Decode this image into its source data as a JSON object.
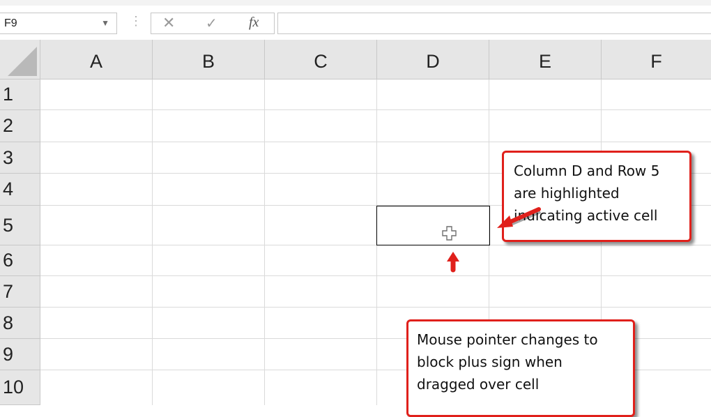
{
  "namebox": {
    "value": "F9"
  },
  "formula": {
    "cancel_symbol": "✕",
    "enter_symbol": "✓",
    "fx_label": "fx",
    "value": ""
  },
  "columns": [
    "A",
    "B",
    "C",
    "D",
    "E",
    "F"
  ],
  "rows": [
    "1",
    "2",
    "3",
    "4",
    "5",
    "6",
    "7",
    "8",
    "9",
    "10"
  ],
  "active_cell": {
    "column": "D",
    "row": "5"
  },
  "annotations": {
    "callout_active_cell": [
      "Column D and Row 5",
      "are highlighted",
      "indicating active cell"
    ],
    "callout_pointer": [
      "Mouse pointer changes to",
      "block plus sign when",
      "dragged over cell"
    ],
    "arrow_color": "#e0201b"
  },
  "cursor": {
    "type": "block-plus-icon"
  }
}
